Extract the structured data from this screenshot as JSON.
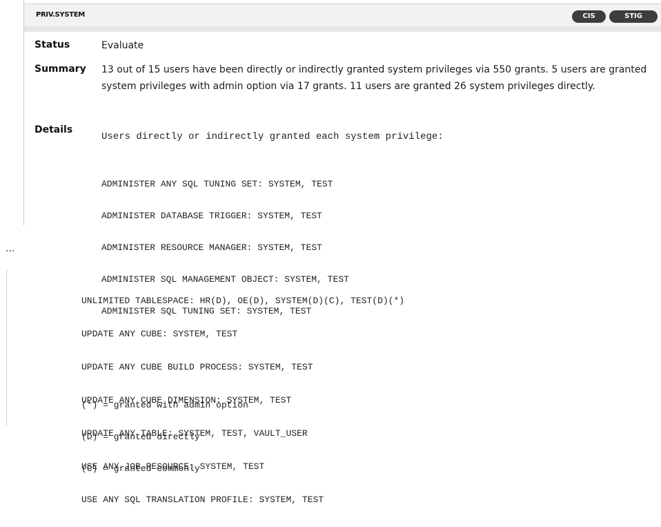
{
  "header": {
    "title": "PRIV.SYSTEM",
    "tags": [
      "CIS",
      "STIG"
    ]
  },
  "status": {
    "label": "Status",
    "value": "Evaluate"
  },
  "summary": {
    "label": "Summary",
    "value": "13 out of 15 users have been directly or indirectly granted system privileges via 550 grants. 5 users are granted system privileges with admin option via 17 grants. 11 users are granted 26 system privileges directly."
  },
  "details": {
    "label": "Details",
    "intro": "Users directly or indirectly granted each system privilege:",
    "privileges_top": [
      "ADMINISTER ANY SQL TUNING SET: SYSTEM, TEST",
      "ADMINISTER DATABASE TRIGGER: SYSTEM, TEST",
      "ADMINISTER RESOURCE MANAGER: SYSTEM, TEST",
      "ADMINISTER SQL MANAGEMENT OBJECT: SYSTEM, TEST",
      "ADMINISTER SQL TUNING SET: SYSTEM, TEST"
    ],
    "ellipsis": "...",
    "privileges_bottom": [
      "UNLIMITED TABLESPACE: HR(D), OE(D), SYSTEM(D)(C), TEST(D)(*)",
      "UPDATE ANY CUBE: SYSTEM, TEST",
      "UPDATE ANY CUBE BUILD PROCESS: SYSTEM, TEST",
      "UPDATE ANY CUBE DIMENSION: SYSTEM, TEST",
      "UPDATE ANY TABLE: SYSTEM, TEST, VAULT_USER",
      "USE ANY JOB RESOURCE: SYSTEM, TEST",
      "USE ANY SQL TRANSLATION PROFILE: SYSTEM, TEST"
    ],
    "legend": [
      "(*) = granted with admin option",
      "(D) = granted directly",
      "(C) = granted commonly"
    ]
  }
}
